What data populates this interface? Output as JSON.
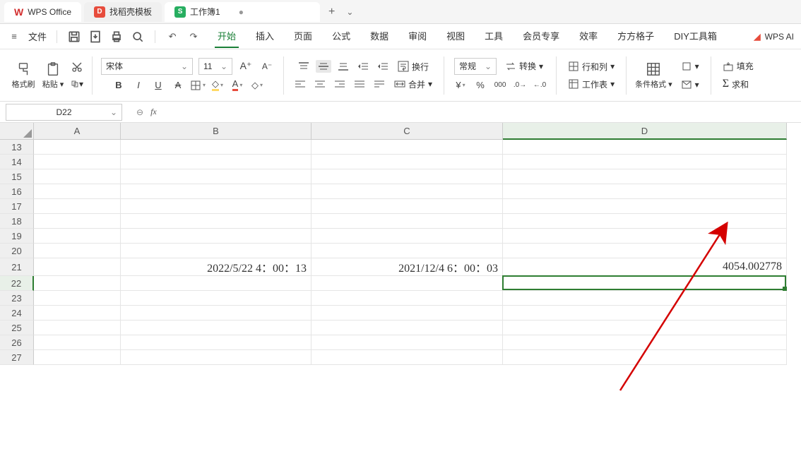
{
  "titlebar": {
    "app_name": "WPS Office",
    "tab1": "找稻壳模板",
    "tab2": "工作簿1",
    "tab2_badge": "S"
  },
  "menubar": {
    "file": "文件",
    "items": [
      "开始",
      "插入",
      "页面",
      "公式",
      "数据",
      "审阅",
      "视图",
      "工具",
      "会员专享",
      "效率",
      "方方格子",
      "DIY工具箱"
    ],
    "active_index": 0,
    "wps_ai": "WPS AI"
  },
  "ribbon": {
    "format_painter": "格式刷",
    "paste": "粘贴",
    "font_name": "宋体",
    "font_size": "11",
    "wrap": "换行",
    "merge": "合并",
    "number_format": "常规",
    "convert": "转换",
    "rowcol": "行和列",
    "worksheet": "工作表",
    "cond_fmt": "条件格式",
    "fill": "填充",
    "sum": "求和"
  },
  "namebox": "D22",
  "grid": {
    "columns": [
      "A",
      "B",
      "C",
      "D"
    ],
    "active_col_index": 3,
    "row_start": 13,
    "row_end": 27,
    "active_row": 22,
    "data_row": 21,
    "cells": {
      "B21": "2022/5/22 4：00：13",
      "C21": "2021/12/4 6：00：03",
      "D21": "4054.002778"
    },
    "selection": {
      "col": "D",
      "row": 22
    }
  }
}
